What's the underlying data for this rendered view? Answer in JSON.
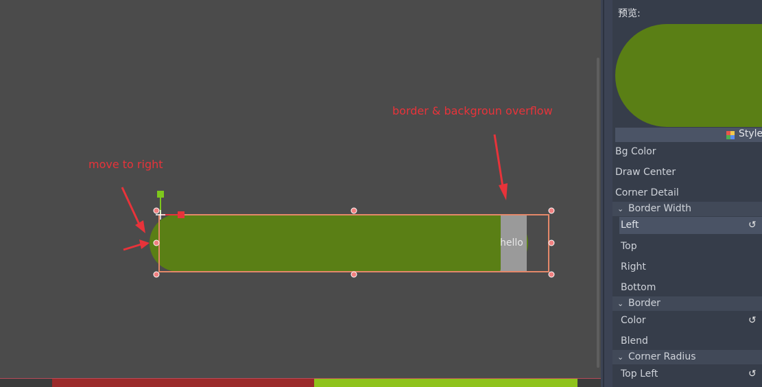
{
  "colors": {
    "panel_fill": "#5a7f15",
    "accent_red": "#e8333a",
    "selection_orange": "#e5886a",
    "handle_fill": "#f08080",
    "anchor_green": "#7ec81c",
    "strip_red": "#9b2a2a",
    "strip_green": "#8fc31c"
  },
  "annotations": {
    "overflow_note": "border & backgroun overflow",
    "move_note": "move to right"
  },
  "canvas": {
    "label_text": "hello"
  },
  "inspector": {
    "preview_label": "预览:",
    "style_button": "StyleB",
    "properties": [
      {
        "label": "Bg Color"
      },
      {
        "label": "Draw Center"
      },
      {
        "label": "Corner Detail"
      }
    ],
    "sections": {
      "border_width": {
        "title": "Border Width",
        "items": [
          "Left",
          "Top",
          "Right",
          "Bottom"
        ]
      },
      "border": {
        "title": "Border",
        "items": [
          "Color",
          "Blend"
        ]
      },
      "corner_radius": {
        "title": "Corner Radius",
        "items": [
          "Top Left"
        ]
      }
    },
    "reset_glyph": "↺",
    "chevron_glyph": "⌄"
  }
}
